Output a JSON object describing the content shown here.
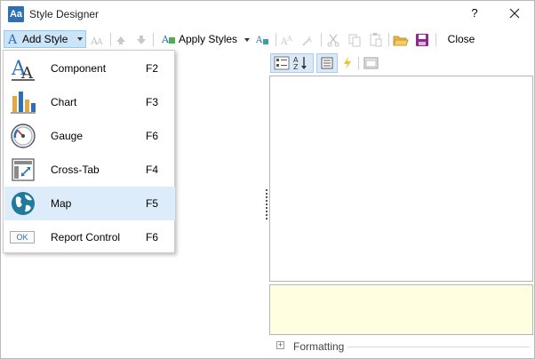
{
  "window": {
    "title": "Style Designer",
    "help_label": "?",
    "close_glyph": "✕"
  },
  "toolbar": {
    "add_style_label": "Add Style",
    "apply_styles_label": "Apply Styles",
    "close_label": "Close",
    "icons": [
      "add-style-icon",
      "duplicate-style-icon",
      "move-up-icon",
      "move-down-icon",
      "apply-styles-icon",
      "style-ab-icon",
      "style-ba-icon",
      "cut-icon",
      "copy-icon",
      "paste-icon",
      "open-folder-icon",
      "save-icon"
    ]
  },
  "menu": {
    "items": [
      {
        "label": "Component",
        "shortcut": "F2",
        "icon": "component-icon",
        "highlighted": false
      },
      {
        "label": "Chart",
        "shortcut": "F3",
        "icon": "chart-icon",
        "highlighted": false
      },
      {
        "label": "Gauge",
        "shortcut": "F6",
        "icon": "gauge-icon",
        "highlighted": false
      },
      {
        "label": "Cross-Tab",
        "shortcut": "F4",
        "icon": "crosstab-icon",
        "highlighted": false
      },
      {
        "label": "Map",
        "shortcut": "F5",
        "icon": "map-icon",
        "highlighted": true
      },
      {
        "label": "Report Control",
        "shortcut": "F6",
        "icon": "ok-control-icon",
        "highlighted": false
      }
    ],
    "ok_icon_text": "OK"
  },
  "properties": {
    "toolbar_icons": [
      "categorized-icon",
      "alphabetical-icon",
      "properties-icon",
      "events-icon",
      "property-pages-icon"
    ],
    "group_label": "Formatting",
    "group_toggle": "+"
  },
  "colors": {
    "accent": "#2f6fb5",
    "highlight": "#ddecfa",
    "button_selected": "#cce4f7",
    "description_bg": "#fffee0"
  }
}
